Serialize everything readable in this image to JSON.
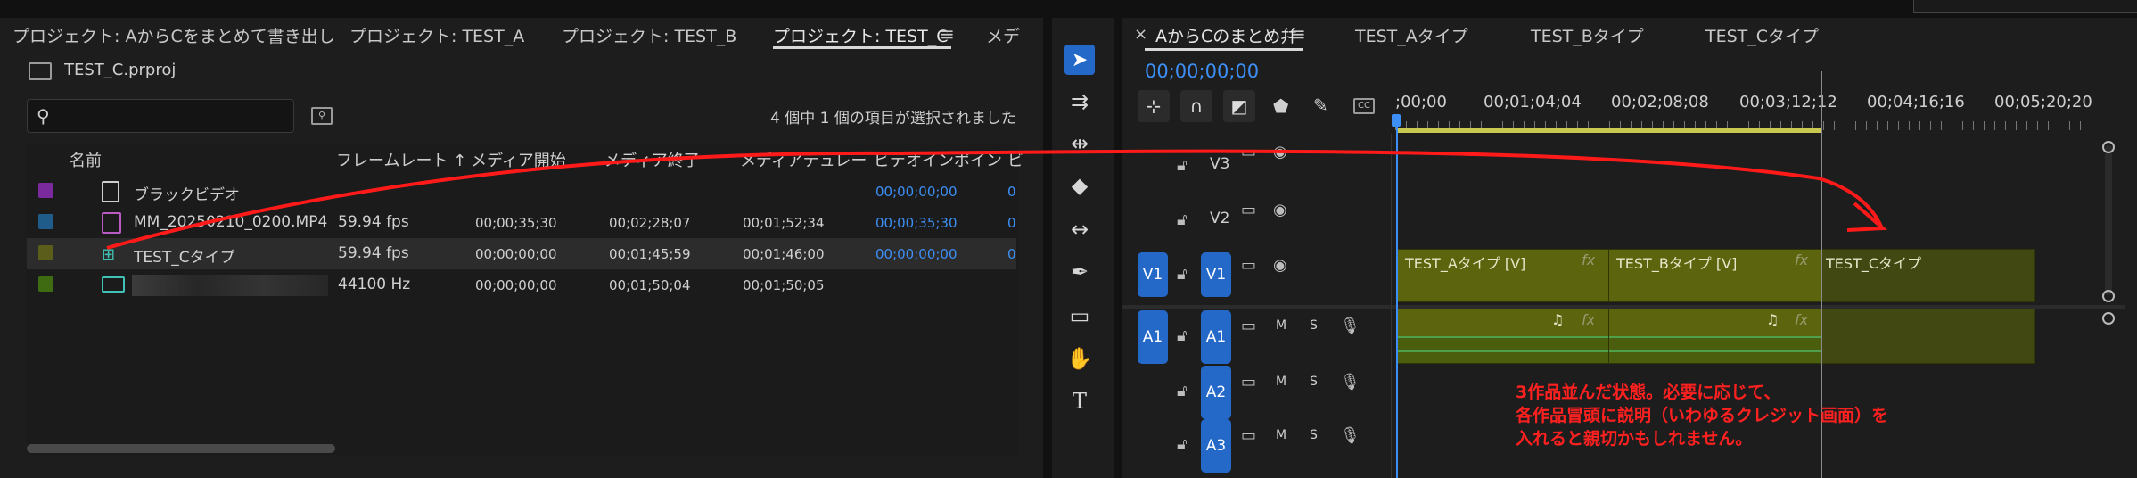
{
  "project_panel": {
    "tabs": [
      {
        "label": "プロジェクト: AからCをまとめて書き出し",
        "active": false
      },
      {
        "label": "プロジェクト: TEST_A",
        "active": false
      },
      {
        "label": "プロジェクト: TEST_B",
        "active": false
      },
      {
        "label": "プロジェクト: TEST_C",
        "active": true
      },
      {
        "label": "メデ",
        "active": false
      }
    ],
    "project_file": "TEST_C.prproj",
    "search_placeholder": "",
    "selection_status": "4 個中 1 個の項目が選択されました",
    "columns": [
      "名前",
      "フレームレート ↑",
      "メディア開始",
      "メディア終了",
      "メディアデュレー",
      "ビデオインポイン",
      "ビ"
    ],
    "rows": [
      {
        "color": "#7b2a9e",
        "icon": "black-video-icon",
        "name": "ブラックビデオ",
        "fps": "",
        "start": "",
        "end": "",
        "duration": "",
        "in": "00;00;00;00",
        "extra": "0"
      },
      {
        "color": "#1f5c8a",
        "icon": "video-file-icon",
        "name": "MM_20250210_0200.MP4",
        "fps": "59.94 fps",
        "start": "00;00;35;30",
        "end": "00;02;28;07",
        "duration": "00;01;52;34",
        "in": "00;00;35;30",
        "extra": "0"
      },
      {
        "color": "#5b5e1a",
        "icon": "sequence-icon",
        "name": "TEST_Cタイプ",
        "fps": "59.94 fps",
        "start": "00;00;00;00",
        "end": "00;01;45;59",
        "duration": "00;01;46;00",
        "in": "00;00;00;00",
        "extra": "0"
      },
      {
        "color": "#3f6b12",
        "icon": "audio-file-icon",
        "name": "",
        "fps": "44100 Hz",
        "start": "00;00;00;00",
        "end": "00;01;50;04",
        "duration": "00;01;50;05",
        "in": "",
        "extra": ""
      }
    ]
  },
  "tools": [
    {
      "name": "selection-tool-icon",
      "glyph": "➤",
      "active": true
    },
    {
      "name": "track-select-icon",
      "glyph": "⇉",
      "active": false
    },
    {
      "name": "ripple-edit-icon",
      "glyph": "⇹",
      "active": false
    },
    {
      "name": "razor-icon",
      "glyph": "◆",
      "active": false
    },
    {
      "name": "slip-icon",
      "glyph": "↔",
      "active": false
    },
    {
      "name": "pen-icon",
      "glyph": "✒",
      "active": false
    },
    {
      "name": "rectangle-icon",
      "glyph": "▭",
      "active": false
    },
    {
      "name": "hand-icon",
      "glyph": "✋",
      "active": false
    },
    {
      "name": "type-icon",
      "glyph": "T",
      "active": false
    }
  ],
  "timeline": {
    "tabs": [
      {
        "label": "AからCのまとめ幷",
        "active": true
      },
      {
        "label": "TEST_Aタイプ",
        "active": false
      },
      {
        "label": "TEST_Bタイプ",
        "active": false
      },
      {
        "label": "TEST_Cタイプ",
        "active": false
      }
    ],
    "close_glyph": "×",
    "menu_glyph": "≡",
    "timecode": "00;00;00;00",
    "ruler": [
      ";00;00",
      "00;01;04;04",
      "00;02;08;08",
      "00;03;12;12",
      "00;04;16;16",
      "00;05;20;20"
    ],
    "tracks": {
      "v3": "V3",
      "v2": "V2",
      "v1": "V1",
      "v1_src": "V1",
      "a1": "A1",
      "a1_src": "A1",
      "a2": "A2",
      "a3": "A3",
      "m": "M",
      "s": "S"
    },
    "clips": {
      "video": [
        "TEST_Aタイプ [V]",
        "TEST_Bタイプ [V]",
        "TEST_Cタイプ"
      ],
      "fx": "fx"
    }
  },
  "annotation": [
    "3作品並んだ状態。必要に応じて、",
    "各作品冒頭に説明（いわゆるクレジット画面）を",
    "入れると親切かもしれません。"
  ],
  "colors": {
    "accent_blue": "#2468c8",
    "clip_video": "#5c650e",
    "annotation_red": "#ff2020"
  }
}
